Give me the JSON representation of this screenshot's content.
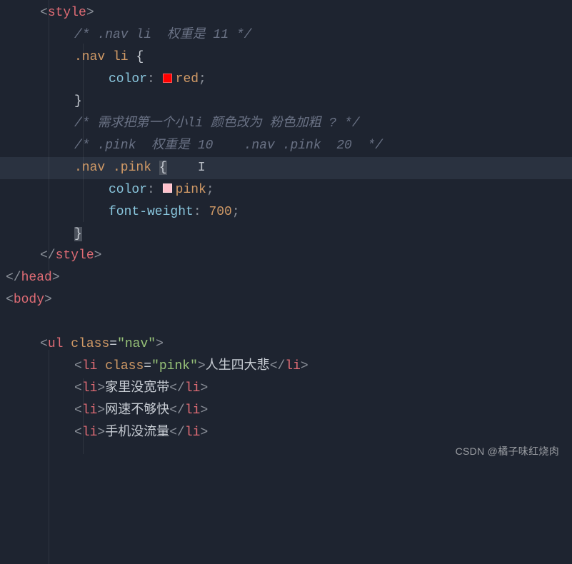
{
  "colors": {
    "red": "#ff0000",
    "pink": "#ffc0cb"
  },
  "lines": {
    "style_open": "style",
    "cmt1": "/* .nav li  权重是 11 */",
    "sel1": ".nav li",
    "prop1": "color",
    "val1": "red",
    "cmt2": "/* 需求把第一个小li 颜色改为 粉色加粗 ? */",
    "cmt3": "/* .pink  权重是 10    .nav .pink  20  */",
    "sel2": ".nav .pink",
    "prop2a": "color",
    "val2a": "pink",
    "prop2b": "font-weight",
    "val2b": "700",
    "style_close": "style",
    "head_close": "head",
    "body_open": "body",
    "ul_tag": "ul",
    "ul_attr": "class",
    "ul_val": "\"nav\"",
    "li_tag": "li",
    "li_attr": "class",
    "li_val": "\"pink\"",
    "li1_txt": "人生四大悲",
    "li2_txt": "家里没宽带",
    "li3_txt": "网速不够快",
    "li4_txt": "手机没流量"
  },
  "watermark": "CSDN @橘子味红烧肉"
}
